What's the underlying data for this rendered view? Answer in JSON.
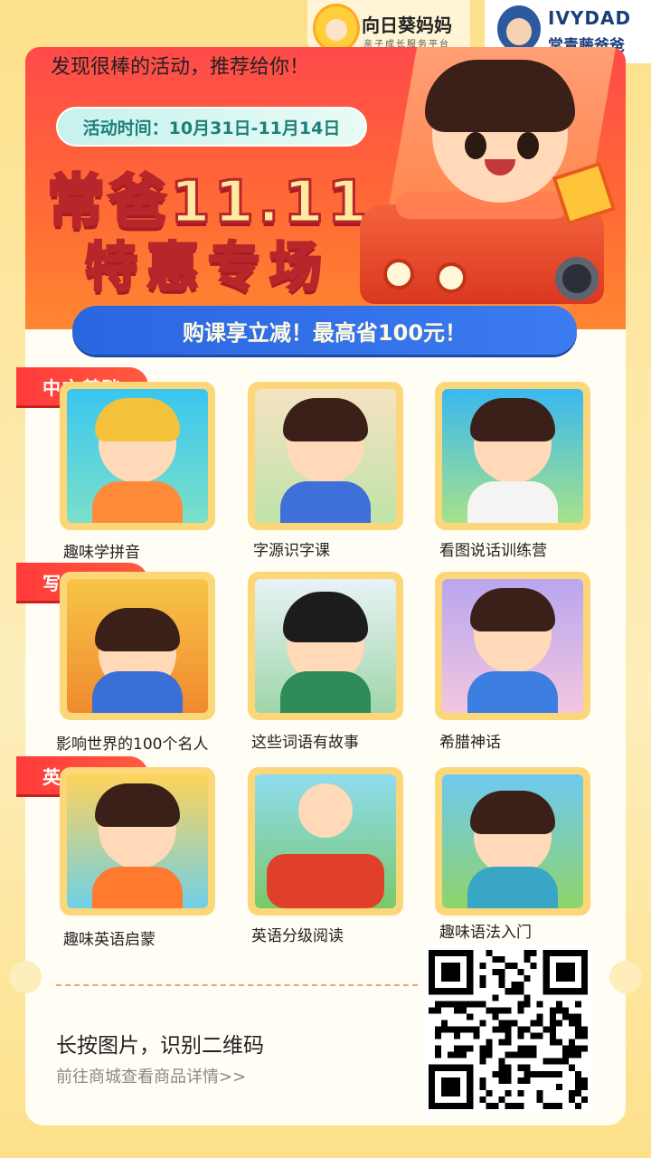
{
  "header": {
    "logo_left_name": "向日葵妈妈",
    "logo_left_sub": "亲子成长服务平台",
    "logo_right_name": "IVYDAD",
    "logo_right_sub": "常青藤爸爸"
  },
  "banner": {
    "slogan": "发现很棒的活动，推荐给你！",
    "time": "活动时间：10月31日-11月14日",
    "headline_1": "常爸11.11",
    "headline_2": "特惠专场",
    "promo": "购课享立减！最高省100元！"
  },
  "sections": [
    {
      "tag": "中文基础",
      "items": [
        "趣味学拼音",
        "字源识字课",
        "看图说话训练营"
      ]
    },
    {
      "tag": "写作积累",
      "items": [
        "影响世界的100个名人",
        "这些词语有故事",
        "希腊神话"
      ]
    },
    {
      "tag": "英文进阶",
      "items": [
        "趣味英语启蒙",
        "英语分级阅读",
        "趣味语法入门"
      ]
    }
  ],
  "footer": {
    "cta_main": "长按图片，识别二维码",
    "cta_sub": "前往商城查看商品详情>>"
  }
}
